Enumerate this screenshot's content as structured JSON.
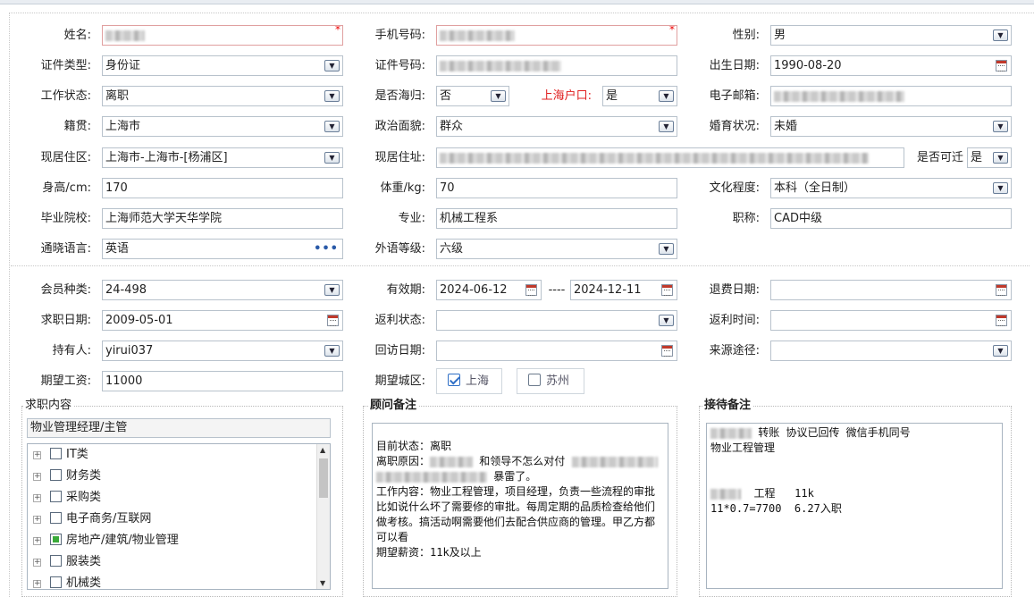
{
  "personal": {
    "name_label": "姓名:",
    "phone_label": "手机号码:",
    "gender_label": "性别:",
    "gender_value": "男",
    "id_type_label": "证件类型:",
    "id_type_value": "身份证",
    "id_no_label": "证件号码:",
    "birth_label": "出生日期:",
    "birth_value": "1990-08-20",
    "work_status_label": "工作状态:",
    "work_status_value": "离职",
    "overseas_label": "是否海归:",
    "overseas_value": "否",
    "sh_hukou_label": "上海户口:",
    "sh_hukou_value": "是",
    "email_label": "电子邮箱:",
    "native_label": "籍贯:",
    "native_value": "上海市",
    "political_label": "政治面貌:",
    "political_value": "群众",
    "marital_label": "婚育状况:",
    "marital_value": "未婚",
    "district_label": "现居住区:",
    "district_value": "上海市-上海市-[杨浦区]",
    "address_label": "现居住址:",
    "movable_label": "是否可迁",
    "movable_value": "是",
    "height_label": "身高/cm:",
    "height_value": "170",
    "weight_label": "体重/kg:",
    "weight_value": "70",
    "education_label": "文化程度:",
    "education_value": "本科（全日制）",
    "school_label": "毕业院校:",
    "school_value": "上海师范大学天华学院",
    "major_label": "专业:",
    "major_value": "机械工程系",
    "title_label": "职称:",
    "title_value": "CAD中级",
    "language_label": "通晓语言:",
    "language_value": "英语",
    "lang_level_label": "外语等级:",
    "lang_level_value": "六级",
    "required_mark": "*",
    "more_icon": "•••"
  },
  "membership": {
    "type_label": "会员种类:",
    "type_value": "24-498",
    "validity_label": "有效期:",
    "validity_start": "2024-06-12",
    "validity_sep": "----",
    "validity_end": "2024-12-11",
    "refund_date_label": "退费日期:",
    "job_date_label": "求职日期:",
    "job_date_value": "2009-05-01",
    "rebate_status_label": "返利状态:",
    "rebate_time_label": "返利时间:",
    "holder_label": "持有人:",
    "holder_value": "yirui037",
    "revisit_label": "回访日期:",
    "source_label": "来源途径:",
    "salary_label": "期望工资:",
    "salary_value": "11000",
    "city_label": "期望城区:",
    "cities": [
      {
        "label": "上海",
        "checked": true
      },
      {
        "label": "苏州",
        "checked": false
      }
    ]
  },
  "job_panel": {
    "title": "求职内容",
    "selected": "物业管理经理/主管",
    "tree": [
      {
        "label": "IT类",
        "state": "none"
      },
      {
        "label": "财务类",
        "state": "none"
      },
      {
        "label": "采购类",
        "state": "none"
      },
      {
        "label": "电子商务/互联网",
        "state": "none"
      },
      {
        "label": "房地产/建筑/物业管理",
        "state": "partial"
      },
      {
        "label": "服装类",
        "state": "none"
      },
      {
        "label": "机械类",
        "state": "none"
      }
    ]
  },
  "advisor_panel": {
    "title": "顾问备注",
    "lines": [
      "目前状态：离职",
      "离职原因：",
      "和领导不怎么对付",
      "暴雷了。",
      "工作内容：物业工程管理，项目经理，负责一些流程的审批 比如说什么坏了需要修的审批。每周定期的品质检查给他们做考核。搞活动啊需要他们去配合供应商的管理。甲乙方都可以看",
      "期望薪资：11k及以上"
    ]
  },
  "reception_panel": {
    "title": "接待备注",
    "line1": "转账 协议已回传 微信手机同号",
    "line2": "物业工程管理",
    "line3": "工程   11k",
    "line4": "11*0.7=7700  6.27入职"
  }
}
